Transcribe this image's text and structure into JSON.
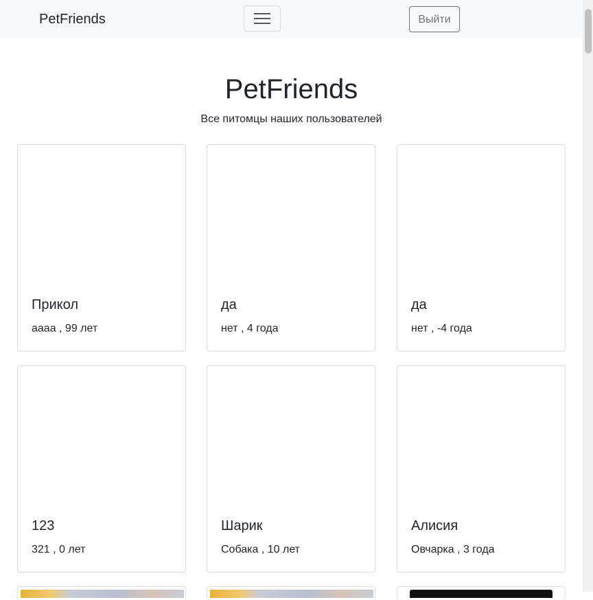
{
  "navbar": {
    "brand": "PetFriends",
    "logout_label": "Выйти"
  },
  "header": {
    "title": "PetFriends",
    "subtitle": "Все питомцы наших пользователей"
  },
  "pets": [
    {
      "name": "Прикол",
      "info": "аааа , 99 лет"
    },
    {
      "name": "да",
      "info": "нет , 4 года"
    },
    {
      "name": "да",
      "info": "нет , -4 года"
    },
    {
      "name": "123",
      "info": "321 , 0 лет"
    },
    {
      "name": "Шарик",
      "info": "Собака , 10 лет"
    },
    {
      "name": "Алисия",
      "info": "Овчарка , 3 года"
    }
  ],
  "icons": {
    "toggler": "hamburger-menu-icon"
  }
}
